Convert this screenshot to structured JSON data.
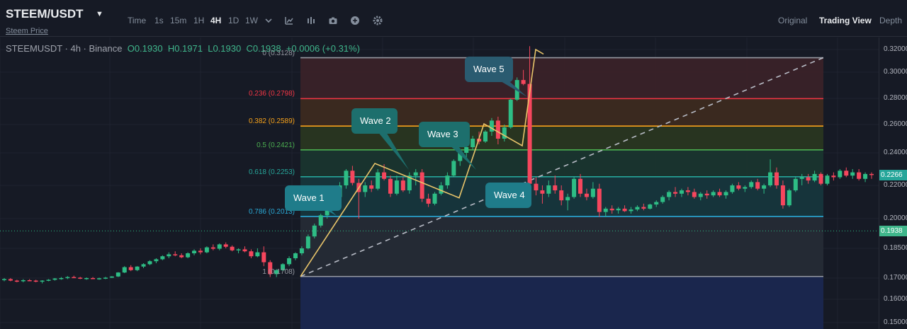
{
  "header": {
    "pair": "STEEM/USDT",
    "subtitle": "Steem Price",
    "caret_icon": "caret-down-icon",
    "timeframes": [
      "Time",
      "1s",
      "15m",
      "1H",
      "4H",
      "1D",
      "1W"
    ],
    "active_timeframe": "4H",
    "toolbar_icons": [
      "dropdown-caret-icon",
      "indicator-icon",
      "chart-style-icon",
      "camera-icon",
      "plus-circle-icon",
      "gear-icon"
    ],
    "views": [
      "Original",
      "Trading View",
      "Depth"
    ],
    "active_view": "Trading View"
  },
  "legend": {
    "symbol": "STEEMUSDT · 4h · Binance",
    "open": "O0.1930",
    "high": "H0.1971",
    "low": "L0.1930",
    "close": "C0.1938",
    "change": "+0.0006 (+0.31%)"
  },
  "axis": {
    "ticks": [
      "0.32000",
      "0.30000",
      "0.28000",
      "0.26000",
      "0.24000",
      "0.22000",
      "0.20000",
      "0.18500",
      "0.17000",
      "0.16000",
      "0.15000"
    ],
    "tags": [
      {
        "label": "0.2266",
        "color": "#26a69a",
        "price": 0.2266
      },
      {
        "label": "0.1938",
        "color": "#3fb68b",
        "price": 0.1938
      }
    ]
  },
  "fib": {
    "levels": [
      {
        "label": "0 (0.3128)",
        "price": 0.3128,
        "color": "#9598a1",
        "zone": "#3b2228"
      },
      {
        "label": "0.236 (0.2798)",
        "price": 0.2798,
        "color": "#f23645",
        "zone": "#3e2a1e"
      },
      {
        "label": "0.382 (0.2589)",
        "price": 0.2589,
        "color": "#f7a21b",
        "zone": "#2a361f"
      },
      {
        "label": "0.5 (0.2421)",
        "price": 0.2421,
        "color": "#4caf50",
        "zone": "#1a352f"
      },
      {
        "label": "0.618 (0.2253)",
        "price": 0.2253,
        "color": "#26a69a",
        "zone": "#17363d"
      },
      {
        "label": "0.786 (0.2013)",
        "price": 0.2013,
        "color": "#2aa9d6",
        "zone": "#262b35"
      },
      {
        "label": "1 (0.1708)",
        "price": 0.1708,
        "color": "#9598a1",
        "zone": "#1b2750"
      }
    ]
  },
  "waves": [
    {
      "label": "Wave 1",
      "bg": "#1f7c8a",
      "tip": [
        475,
        305
      ]
    },
    {
      "label": "Wave 2",
      "bg": "#1d6f6d",
      "tip": [
        577,
        240
      ]
    },
    {
      "label": "Wave 3",
      "bg": "#1d6f6d",
      "tip": [
        672,
        240
      ]
    },
    {
      "label": "Wave 4",
      "bg": "#1f7c8a",
      "tip": [
        718,
        265
      ]
    },
    {
      "label": "Wave 5",
      "bg": "#2a5b70",
      "tip": [
        744,
        137
      ]
    }
  ],
  "elliott_points": [
    [
      "p0",
      0.1708
    ],
    [
      "p1",
      0.2335
    ],
    [
      "p2",
      0.2125
    ],
    [
      "p3",
      0.2605
    ],
    [
      "p4",
      0.245
    ],
    [
      "p5",
      0.32
    ],
    [
      "p6",
      0.316
    ]
  ],
  "chart_data": {
    "type": "candlestick",
    "symbol": "STEEMUSDT",
    "interval": "4h",
    "ylim": [
      0.15,
      0.32
    ],
    "candles_ohlc": [
      [
        0.169,
        0.17,
        0.1685,
        0.1695
      ],
      [
        0.1695,
        0.17,
        0.1685,
        0.1688
      ],
      [
        0.1688,
        0.1692,
        0.168,
        0.1685
      ],
      [
        0.1685,
        0.1695,
        0.168,
        0.169
      ],
      [
        0.169,
        0.1695,
        0.1685,
        0.1688
      ],
      [
        0.1688,
        0.1692,
        0.168,
        0.1684
      ],
      [
        0.1684,
        0.169,
        0.1675,
        0.1688
      ],
      [
        0.1688,
        0.1695,
        0.1685,
        0.1692
      ],
      [
        0.1692,
        0.17,
        0.1688,
        0.1698
      ],
      [
        0.1698,
        0.1705,
        0.1692,
        0.17
      ],
      [
        0.17,
        0.171,
        0.1695,
        0.1705
      ],
      [
        0.1705,
        0.1712,
        0.17,
        0.1702
      ],
      [
        0.1702,
        0.1706,
        0.1695,
        0.1698
      ],
      [
        0.1698,
        0.1703,
        0.1692,
        0.17
      ],
      [
        0.17,
        0.1705,
        0.1695,
        0.1697
      ],
      [
        0.1697,
        0.1702,
        0.1692,
        0.1699
      ],
      [
        0.1699,
        0.1706,
        0.1695,
        0.1702
      ],
      [
        0.1702,
        0.171,
        0.17,
        0.1708
      ],
      [
        0.1708,
        0.173,
        0.1705,
        0.1728
      ],
      [
        0.1728,
        0.176,
        0.1725,
        0.1755
      ],
      [
        0.1755,
        0.1765,
        0.1735,
        0.174
      ],
      [
        0.174,
        0.176,
        0.1735,
        0.1758
      ],
      [
        0.1758,
        0.1775,
        0.175,
        0.177
      ],
      [
        0.177,
        0.179,
        0.1765,
        0.1785
      ],
      [
        0.1785,
        0.18,
        0.1775,
        0.1795
      ],
      [
        0.1795,
        0.1815,
        0.179,
        0.181
      ],
      [
        0.181,
        0.183,
        0.18,
        0.182
      ],
      [
        0.182,
        0.1835,
        0.181,
        0.1815
      ],
      [
        0.1815,
        0.1825,
        0.18,
        0.1805
      ],
      [
        0.1805,
        0.183,
        0.18,
        0.1825
      ],
      [
        0.1825,
        0.1845,
        0.1815,
        0.1838
      ],
      [
        0.1838,
        0.185,
        0.182,
        0.183
      ],
      [
        0.183,
        0.186,
        0.1825,
        0.1855
      ],
      [
        0.1855,
        0.187,
        0.184,
        0.1848
      ],
      [
        0.1848,
        0.1875,
        0.184,
        0.187
      ],
      [
        0.187,
        0.188,
        0.185,
        0.1858
      ],
      [
        0.1858,
        0.1865,
        0.1835,
        0.184
      ],
      [
        0.184,
        0.185,
        0.1825,
        0.1845
      ],
      [
        0.1845,
        0.186,
        0.183,
        0.1835
      ],
      [
        0.1835,
        0.1845,
        0.18,
        0.181
      ],
      [
        0.181,
        0.185,
        0.1805,
        0.183
      ],
      [
        0.183,
        0.186,
        0.176,
        0.178
      ],
      [
        0.178,
        0.179,
        0.1705,
        0.172
      ],
      [
        0.172,
        0.1745,
        0.1705,
        0.174
      ],
      [
        0.174,
        0.1775,
        0.1735,
        0.177
      ],
      [
        0.177,
        0.181,
        0.176,
        0.18
      ],
      [
        0.18,
        0.183,
        0.179,
        0.1825
      ],
      [
        0.1825,
        0.186,
        0.1815,
        0.185
      ],
      [
        0.185,
        0.192,
        0.1845,
        0.191
      ],
      [
        0.191,
        0.1975,
        0.19,
        0.1965
      ],
      [
        0.1965,
        0.203,
        0.1955,
        0.202
      ],
      [
        0.202,
        0.208,
        0.2,
        0.207
      ],
      [
        0.207,
        0.214,
        0.205,
        0.213
      ],
      [
        0.213,
        0.222,
        0.211,
        0.22
      ],
      [
        0.22,
        0.23,
        0.218,
        0.229
      ],
      [
        0.229,
        0.232,
        0.22,
        0.2215
      ],
      [
        0.2215,
        0.224,
        0.2,
        0.216
      ],
      [
        0.216,
        0.222,
        0.213,
        0.22
      ],
      [
        0.22,
        0.223,
        0.216,
        0.218
      ],
      [
        0.218,
        0.23,
        0.217,
        0.228
      ],
      [
        0.228,
        0.233,
        0.223,
        0.224
      ],
      [
        0.224,
        0.226,
        0.213,
        0.215
      ],
      [
        0.215,
        0.226,
        0.214,
        0.223
      ],
      [
        0.223,
        0.225,
        0.216,
        0.217
      ],
      [
        0.217,
        0.228,
        0.215,
        0.226
      ],
      [
        0.226,
        0.23,
        0.22,
        0.228
      ],
      [
        0.228,
        0.23,
        0.21,
        0.212
      ],
      [
        0.212,
        0.215,
        0.207,
        0.209
      ],
      [
        0.209,
        0.216,
        0.208,
        0.215
      ],
      [
        0.215,
        0.222,
        0.214,
        0.22
      ],
      [
        0.22,
        0.228,
        0.218,
        0.226
      ],
      [
        0.226,
        0.236,
        0.225,
        0.235
      ],
      [
        0.235,
        0.241,
        0.232,
        0.24
      ],
      [
        0.24,
        0.245,
        0.237,
        0.244
      ],
      [
        0.244,
        0.252,
        0.242,
        0.25
      ],
      [
        0.25,
        0.255,
        0.246,
        0.248
      ],
      [
        0.248,
        0.256,
        0.247,
        0.255
      ],
      [
        0.255,
        0.265,
        0.252,
        0.263
      ],
      [
        0.263,
        0.266,
        0.246,
        0.25
      ],
      [
        0.25,
        0.26,
        0.248,
        0.258
      ],
      [
        0.258,
        0.28,
        0.257,
        0.279
      ],
      [
        0.279,
        0.296,
        0.278,
        0.294
      ],
      [
        0.294,
        0.302,
        0.29,
        0.291
      ],
      [
        0.291,
        0.323,
        0.218,
        0.221
      ],
      [
        0.221,
        0.225,
        0.214,
        0.217
      ],
      [
        0.217,
        0.22,
        0.209,
        0.215
      ],
      [
        0.215,
        0.223,
        0.213,
        0.22
      ],
      [
        0.22,
        0.226,
        0.215,
        0.217
      ],
      [
        0.217,
        0.22,
        0.208,
        0.211
      ],
      [
        0.211,
        0.215,
        0.205,
        0.213
      ],
      [
        0.213,
        0.225,
        0.212,
        0.224
      ],
      [
        0.224,
        0.227,
        0.213,
        0.215
      ],
      [
        0.215,
        0.218,
        0.211,
        0.213
      ],
      [
        0.213,
        0.222,
        0.212,
        0.218
      ],
      [
        0.218,
        0.221,
        0.201,
        0.204
      ],
      [
        0.204,
        0.207,
        0.201,
        0.206
      ],
      [
        0.206,
        0.208,
        0.203,
        0.205
      ],
      [
        0.205,
        0.207,
        0.203,
        0.206
      ],
      [
        0.206,
        0.208,
        0.204,
        0.2045
      ],
      [
        0.2045,
        0.207,
        0.203,
        0.2055
      ],
      [
        0.2055,
        0.208,
        0.2045,
        0.207
      ],
      [
        0.207,
        0.209,
        0.205,
        0.206
      ],
      [
        0.206,
        0.209,
        0.2055,
        0.2085
      ],
      [
        0.2085,
        0.211,
        0.207,
        0.21
      ],
      [
        0.21,
        0.214,
        0.209,
        0.213
      ],
      [
        0.213,
        0.217,
        0.211,
        0.216
      ],
      [
        0.216,
        0.219,
        0.213,
        0.215
      ],
      [
        0.215,
        0.218,
        0.213,
        0.217
      ],
      [
        0.217,
        0.219,
        0.214,
        0.216
      ],
      [
        0.216,
        0.218,
        0.212,
        0.213
      ],
      [
        0.213,
        0.216,
        0.211,
        0.215
      ],
      [
        0.215,
        0.217,
        0.212,
        0.214
      ],
      [
        0.214,
        0.217,
        0.213,
        0.216
      ],
      [
        0.216,
        0.218,
        0.213,
        0.214
      ],
      [
        0.214,
        0.217,
        0.212,
        0.216
      ],
      [
        0.216,
        0.221,
        0.215,
        0.22
      ],
      [
        0.22,
        0.222,
        0.217,
        0.218
      ],
      [
        0.218,
        0.22,
        0.216,
        0.219
      ],
      [
        0.219,
        0.223,
        0.218,
        0.222
      ],
      [
        0.222,
        0.224,
        0.217,
        0.218
      ],
      [
        0.218,
        0.221,
        0.215,
        0.22
      ],
      [
        0.22,
        0.236,
        0.219,
        0.228
      ],
      [
        0.228,
        0.231,
        0.218,
        0.22
      ],
      [
        0.22,
        0.223,
        0.206,
        0.208
      ],
      [
        0.208,
        0.218,
        0.207,
        0.217
      ],
      [
        0.217,
        0.225,
        0.216,
        0.224
      ],
      [
        0.224,
        0.227,
        0.22,
        0.225
      ],
      [
        0.225,
        0.227,
        0.221,
        0.223
      ],
      [
        0.223,
        0.229,
        0.222,
        0.227
      ],
      [
        0.227,
        0.228,
        0.22,
        0.221
      ],
      [
        0.221,
        0.227,
        0.22,
        0.226
      ],
      [
        0.226,
        0.228,
        0.223,
        0.225
      ],
      [
        0.225,
        0.23,
        0.224,
        0.229
      ],
      [
        0.229,
        0.231,
        0.225,
        0.226
      ],
      [
        0.226,
        0.23,
        0.224,
        0.228
      ],
      [
        0.228,
        0.23,
        0.223,
        0.224
      ],
      [
        0.224,
        0.228,
        0.222,
        0.227
      ],
      [
        0.227,
        0.228,
        0.224,
        0.2266
      ]
    ]
  }
}
